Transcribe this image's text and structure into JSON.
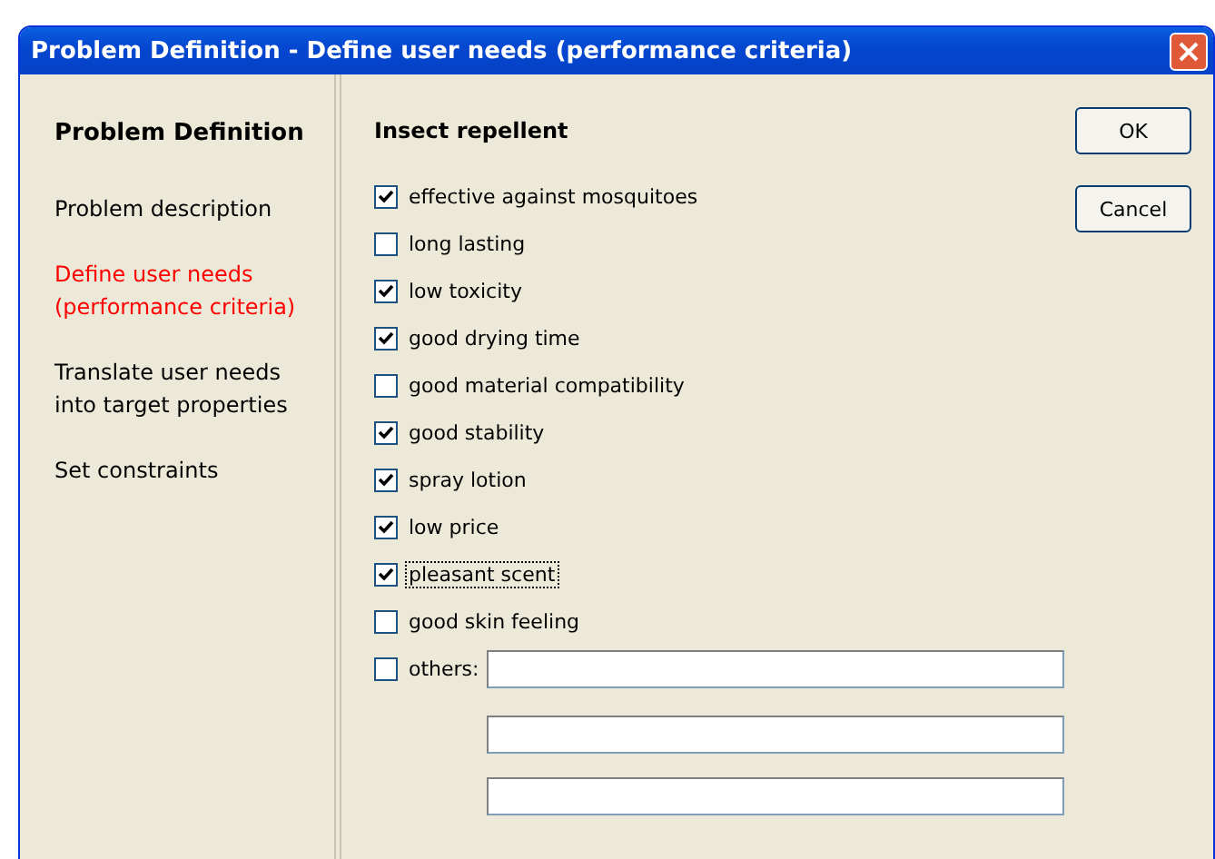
{
  "window": {
    "title": "Problem Definition - Define user needs (performance criteria)"
  },
  "sidebar": {
    "heading": "Problem Definition",
    "items": [
      {
        "label": "Problem description",
        "selected": false
      },
      {
        "label": "Define user needs (performance criteria)",
        "selected": true
      },
      {
        "label": "Translate user needs into target properties",
        "selected": false
      },
      {
        "label": "Set constraints",
        "selected": false
      }
    ]
  },
  "product": "Insect repellent",
  "criteria": [
    {
      "label": "effective against mosquitoes",
      "checked": true,
      "focused": false
    },
    {
      "label": "long lasting",
      "checked": false,
      "focused": false
    },
    {
      "label": "low toxicity",
      "checked": true,
      "focused": false
    },
    {
      "label": "good drying time",
      "checked": true,
      "focused": false
    },
    {
      "label": "good material compatibility",
      "checked": false,
      "focused": false
    },
    {
      "label": "good stability",
      "checked": true,
      "focused": false
    },
    {
      "label": "spray lotion",
      "checked": true,
      "focused": false
    },
    {
      "label": "low price",
      "checked": true,
      "focused": false
    },
    {
      "label": "pleasant scent",
      "checked": true,
      "focused": true
    },
    {
      "label": "good skin feeling",
      "checked": false,
      "focused": false
    }
  ],
  "others": {
    "label": "others:",
    "checked": false,
    "fields": [
      {
        "kind": "text"
      },
      {
        "kind": "text"
      },
      {
        "kind": "text"
      }
    ]
  },
  "buttons": [
    "OK",
    "Cancel"
  ]
}
